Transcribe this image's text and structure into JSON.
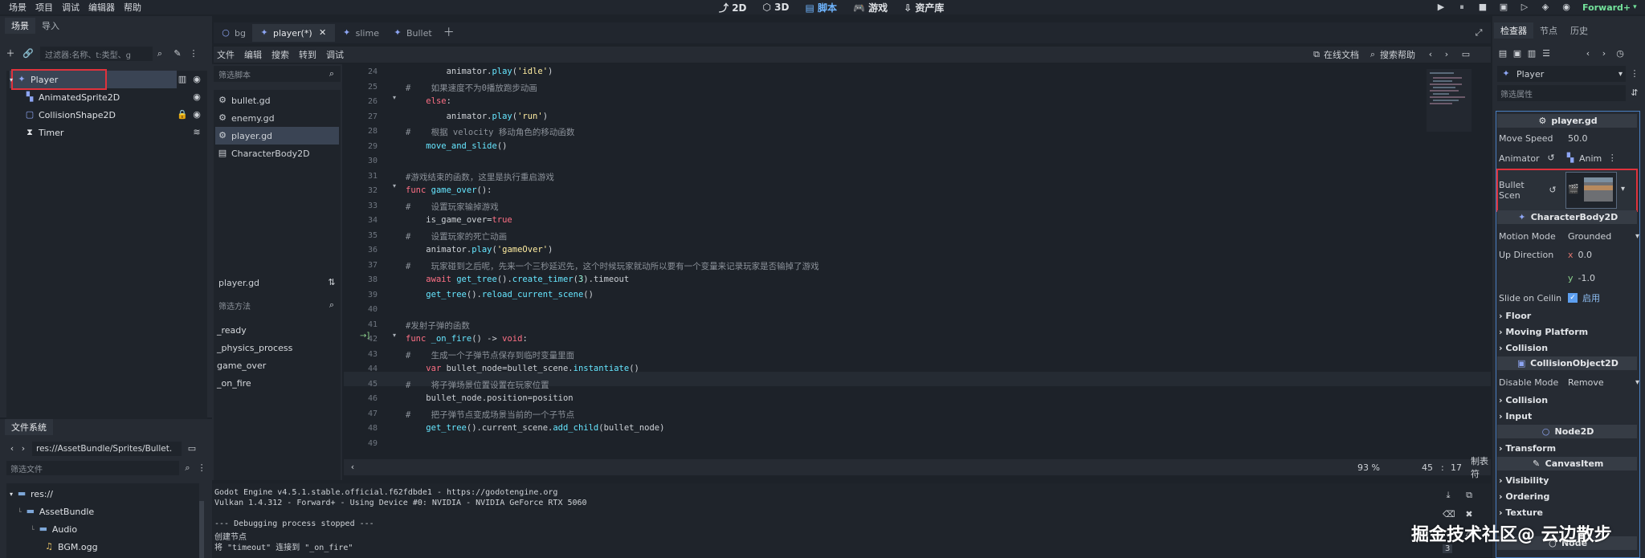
{
  "menu": [
    "场景",
    "项目",
    "调试",
    "编辑器",
    "帮助"
  ],
  "workspaces": [
    {
      "label": "2D",
      "icon": "2d-icon"
    },
    {
      "label": "3D",
      "icon": "3d-icon"
    },
    {
      "label": "脚本",
      "icon": "script-icon"
    },
    {
      "label": "游戏",
      "icon": "game-icon"
    },
    {
      "label": "资产库",
      "icon": "assetlib-icon"
    }
  ],
  "renderer": "Forward+",
  "scene_dock": {
    "tabs": [
      "场景",
      "导入"
    ],
    "filter_placeholder": "过滤器:名称、t:类型、g",
    "nodes": [
      {
        "name": "Player",
        "type": "CharacterBody2D"
      },
      {
        "name": "AnimatedSprite2D"
      },
      {
        "name": "CollisionShape2D"
      },
      {
        "name": "Timer"
      }
    ]
  },
  "filesystem": {
    "tab": "文件系统",
    "path": "res://AssetBundle/Sprites/Bullet.",
    "filter_placeholder": "筛选文件",
    "items": [
      "res://",
      "AssetBundle",
      "Audio",
      "BGM.ogg"
    ]
  },
  "editor_tabs": [
    "bg",
    "player(*)",
    "slime",
    "Bullet"
  ],
  "script_menu": [
    "文件",
    "编辑",
    "搜索",
    "转到",
    "调试"
  ],
  "script_right": {
    "docs": "在线文档",
    "search_help": "搜索帮助"
  },
  "script_list": {
    "filter_placeholder": "筛选脚本",
    "scripts": [
      "bullet.gd",
      "enemy.gd",
      "player.gd",
      "CharacterBody2D"
    ],
    "current": "player.gd",
    "method_filter": "筛选方法",
    "methods": [
      "_ready",
      "_physics_process",
      "game_over",
      "_on_fire"
    ]
  },
  "code": [
    {
      "n": "24",
      "t": "\t\tanimator.play('idle')"
    },
    {
      "n": "25",
      "t": "#\t如果速度不为0播放跑步动画"
    },
    {
      "n": "26",
      "t": "\telse:"
    },
    {
      "n": "27",
      "t": "\t\tanimator.play('run')"
    },
    {
      "n": "28",
      "t": "#\t根据 velocity 移动角色的移动函数"
    },
    {
      "n": "29",
      "t": "\tmove_and_slide()"
    },
    {
      "n": "30",
      "t": ""
    },
    {
      "n": "31",
      "t": "#游戏结束的函数，这里是执行重启游戏"
    },
    {
      "n": "32",
      "t": "func game_over():"
    },
    {
      "n": "33",
      "t": "#\t设置玩家输掉游戏"
    },
    {
      "n": "34",
      "t": "\tis_game_over=true"
    },
    {
      "n": "35",
      "t": "#\t设置玩家的死亡动画"
    },
    {
      "n": "36",
      "t": "\tanimator.play('gameOver')"
    },
    {
      "n": "37",
      "t": "#\t玩家碰到之后呢，先来一个三秒延迟先，这个时候玩家就动所以要有一个变量来记录玩家是否输掉了游戏"
    },
    {
      "n": "38",
      "t": "\tawait get_tree().create_timer(3).timeout"
    },
    {
      "n": "39",
      "t": "\tget_tree().reload_current_scene()"
    },
    {
      "n": "40",
      "t": ""
    },
    {
      "n": "41",
      "t": "#发射子弹的函数"
    },
    {
      "n": "42",
      "t": "func _on_fire() -> void:"
    },
    {
      "n": "43",
      "t": "#\t生成一个子弹节点保存到临时变量里面"
    },
    {
      "n": "44",
      "t": "\tvar bullet_node=bullet_scene.instantiate()"
    },
    {
      "n": "45",
      "t": "#\t将子弹场景位置设置在玩家位置"
    },
    {
      "n": "46",
      "t": "\tbullet_node.position=position"
    },
    {
      "n": "47",
      "t": "#\t把子弹节点变成场景当前的一个子节点"
    },
    {
      "n": "48",
      "t": "\tget_tree().current_scene.add_child(bullet_node)"
    },
    {
      "n": "49",
      "t": ""
    }
  ],
  "status": {
    "zoom": "93 %",
    "line": "45",
    "col": "17",
    "indent": "制表符"
  },
  "output": [
    "Godot Engine v4.5.1.stable.official.f62fdbde1 - https://godotengine.org",
    "Vulkan 1.4.312 - Forward+ - Using Device #0: NVIDIA - NVIDIA GeForce RTX 5060",
    "",
    "--- Debugging process stopped ---",
    "创建节点",
    "将 \"timeout\" 连接到 \"_on_fire\""
  ],
  "output_badge": "3",
  "inspector": {
    "tabs": [
      "检查器",
      "节点",
      "历史"
    ],
    "object": "Player",
    "filter_placeholder": "筛选属性",
    "script_header": "player.gd",
    "move_speed_label": "Move Speed",
    "move_speed": "50.0",
    "animator_label": "Animator",
    "animator_value": "Anim",
    "bullet_label": "Bullet Scen",
    "body_header": "CharacterBody2D",
    "motion_mode_label": "Motion Mode",
    "motion_mode": "Grounded",
    "up_dir_label": "Up Direction",
    "up_x": "0.0",
    "up_y": "-1.0",
    "slide_label": "Slide on Ceilin",
    "slide_value": "启用",
    "groups_a": [
      "Floor",
      "Moving Platform",
      "Collision"
    ],
    "collision_header": "CollisionObject2D",
    "disable_mode_label": "Disable Mode",
    "disable_mode": "Remove",
    "groups_b": [
      "Collision",
      "Input"
    ],
    "node2d_header": "Node2D",
    "groups_c": [
      "Transform"
    ],
    "canvas_header": "CanvasItem",
    "groups_d": [
      "Visibility",
      "Ordering",
      "Texture"
    ],
    "node_header": "Node"
  },
  "watermark": "掘金技术社区@ 云边散步",
  "colors": {
    "accent": "#6fb5ff",
    "highlight_red": "#e0323c",
    "selected": "#3a4454"
  }
}
